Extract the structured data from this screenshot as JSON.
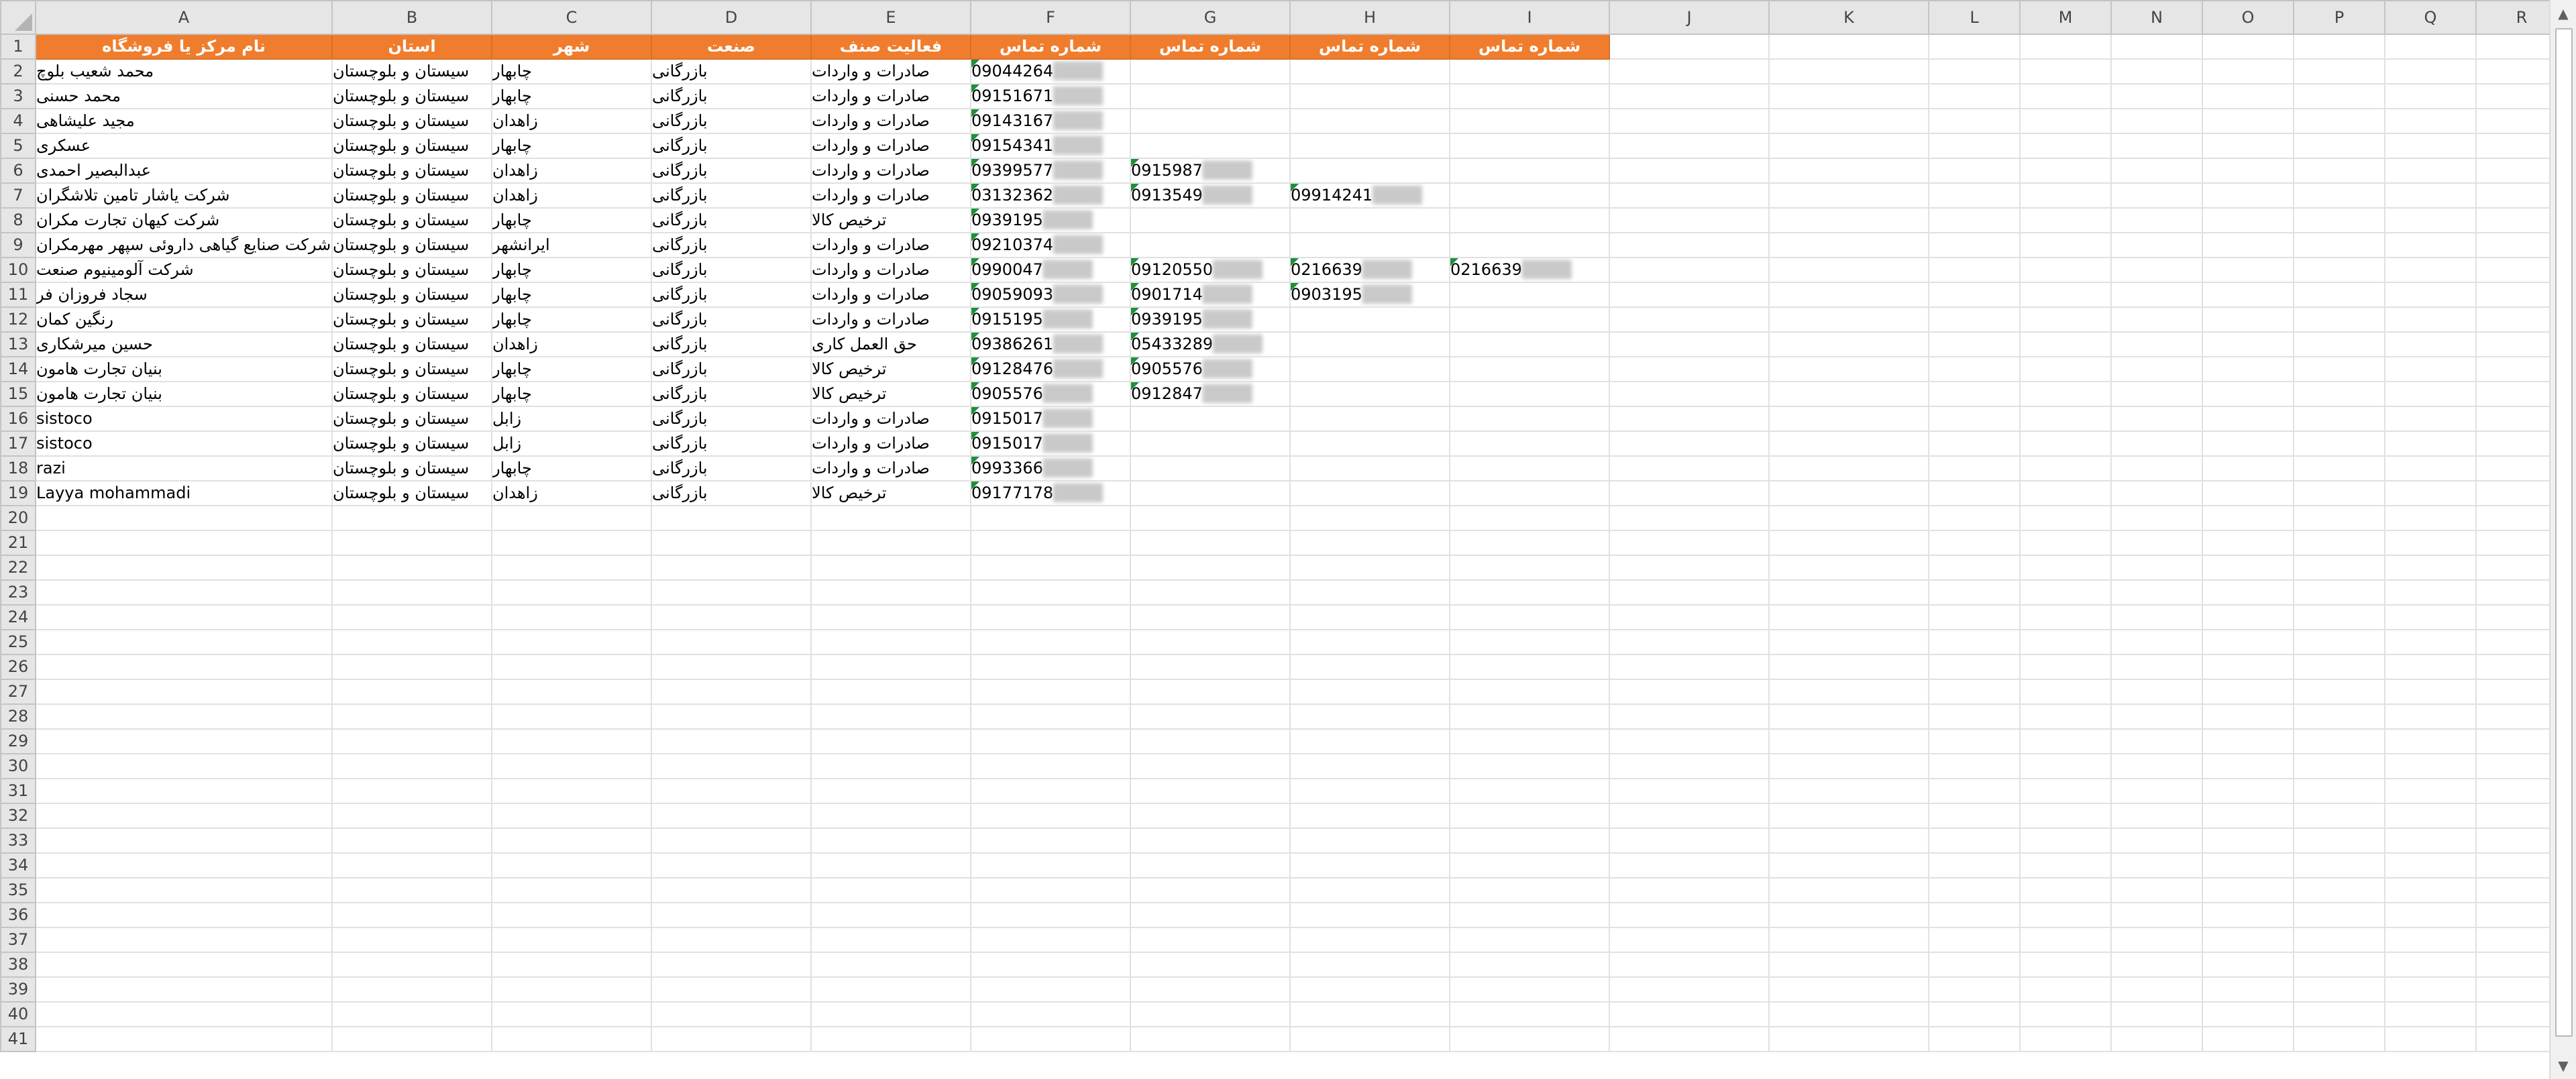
{
  "columns": [
    "A",
    "B",
    "C",
    "D",
    "E",
    "F",
    "G",
    "H",
    "I",
    "J",
    "K",
    "L",
    "M",
    "N",
    "O",
    "P",
    "Q",
    "R"
  ],
  "header": {
    "A": "نام مرکز یا فروشگاه",
    "B": "استان",
    "C": "شهر",
    "D": "صنعت",
    "E": "فعالیت صنف",
    "F": "شماره تماس",
    "G": "شماره تماس",
    "H": "شماره تماس",
    "I": "شماره تماس"
  },
  "rows": [
    {
      "A": "محمد شعیب بلوچ",
      "B": "سیستان و بلوچستان",
      "C": "چابهار",
      "D": "بازرگانی",
      "E": "صادرات و واردات",
      "F": "09044264",
      "G": "",
      "H": "",
      "I": ""
    },
    {
      "A": "محمد حسنی",
      "B": "سیستان و بلوچستان",
      "C": "چابهار",
      "D": "بازرگانی",
      "E": "صادرات و واردات",
      "F": "09151671",
      "G": "",
      "H": "",
      "I": ""
    },
    {
      "A": "مجید علیشاهی",
      "B": "سیستان و بلوچستان",
      "C": "زاهدان",
      "D": "بازرگانی",
      "E": "صادرات و واردات",
      "F": "09143167",
      "G": "",
      "H": "",
      "I": ""
    },
    {
      "A": "عسکری",
      "B": "سیستان و بلوچستان",
      "C": "چابهار",
      "D": "بازرگانی",
      "E": "صادرات و واردات",
      "F": "09154341",
      "G": "",
      "H": "",
      "I": ""
    },
    {
      "A": "عبدالبصیر احمدی",
      "B": "سیستان و بلوچستان",
      "C": "زاهدان",
      "D": "بازرگانی",
      "E": "صادرات و واردات",
      "F": "09399577",
      "G": "0915987",
      "H": "",
      "I": ""
    },
    {
      "A": "شرکت یاشار تامین تلاشگران",
      "B": "سیستان و بلوچستان",
      "C": "زاهدان",
      "D": "بازرگانی",
      "E": "صادرات و واردات",
      "F": "03132362",
      "G": "0913549",
      "H": "09914241",
      "I": ""
    },
    {
      "A": "شرکت کیهان تجارت مکران",
      "B": "سیستان و بلوچستان",
      "C": "چابهار",
      "D": "بازرگانی",
      "E": "ترخیص کالا",
      "F": "0939195",
      "G": "",
      "H": "",
      "I": ""
    },
    {
      "A": "شرکت صنایع گیاهی داروئی سپهر مهرمکران",
      "B": "سیستان و بلوچستان",
      "C": "ایرانشهر",
      "D": "بازرگانی",
      "E": "صادرات و واردات",
      "F": "09210374",
      "G": "",
      "H": "",
      "I": ""
    },
    {
      "A": "شرکت آلومینیوم صنعت",
      "B": "سیستان و بلوچستان",
      "C": "چابهار",
      "D": "بازرگانی",
      "E": "صادرات و واردات",
      "F": "0990047",
      "G": "09120550",
      "H": "0216639",
      "I": "0216639"
    },
    {
      "A": "سجاد فروزان فر",
      "B": "سیستان و بلوچستان",
      "C": "چابهار",
      "D": "بازرگانی",
      "E": "صادرات و واردات",
      "F": "09059093",
      "G": "0901714",
      "H": "0903195",
      "I": ""
    },
    {
      "A": "رنگین کمان",
      "B": "سیستان و بلوچستان",
      "C": "چابهار",
      "D": "بازرگانی",
      "E": "صادرات و واردات",
      "F": "0915195",
      "G": "0939195",
      "H": "",
      "I": ""
    },
    {
      "A": "حسین میرشکاری",
      "B": "سیستان و بلوچستان",
      "C": "زاهدان",
      "D": "بازرگانی",
      "E": "حق العمل کاری",
      "F": "09386261",
      "G": "05433289",
      "H": "",
      "I": ""
    },
    {
      "A": "بنیان تجارت هامون",
      "B": "سیستان و بلوچستان",
      "C": "چابهار",
      "D": "بازرگانی",
      "E": "ترخیص کالا",
      "F": "09128476",
      "G": "0905576",
      "H": "",
      "I": ""
    },
    {
      "A": "بنیان تجارت هامون",
      "B": "سیستان و بلوچستان",
      "C": "چابهار",
      "D": "بازرگانی",
      "E": "ترخیص کالا",
      "F": "0905576",
      "G": "0912847",
      "H": "",
      "I": ""
    },
    {
      "A": "sistoco",
      "B": "سیستان و بلوچستان",
      "C": "زابل",
      "D": "بازرگانی",
      "E": "صادرات و واردات",
      "F": "0915017",
      "G": "",
      "H": "",
      "I": ""
    },
    {
      "A": "sistoco",
      "B": "سیستان و بلوچستان",
      "C": "زابل",
      "D": "بازرگانی",
      "E": "صادرات و واردات",
      "F": "0915017",
      "G": "",
      "H": "",
      "I": ""
    },
    {
      "A": "razi",
      "B": "سیستان و بلوچستان",
      "C": "چابهار",
      "D": "بازرگانی",
      "E": "صادرات و واردات",
      "F": "0993366",
      "G": "",
      "H": "",
      "I": ""
    },
    {
      "A": "Layya mohammadi",
      "B": "سیستان و بلوچستان",
      "C": "زاهدان",
      "D": "بازرگانی",
      "E": "ترخیص کالا",
      "F": "09177178",
      "G": "",
      "H": "",
      "I": ""
    }
  ],
  "row_numbers": [
    "1",
    "2",
    "3",
    "4",
    "5",
    "6",
    "7",
    "8",
    "9",
    "10",
    "11",
    "12",
    "13",
    "14",
    "15",
    "16",
    "17",
    "18",
    "19",
    "20",
    "21",
    "22",
    "23",
    "24",
    "25",
    "26",
    "27",
    "28",
    "29",
    "30",
    "31",
    "32",
    "33",
    "34",
    "35",
    "36",
    "37",
    "38",
    "39",
    "40",
    "41"
  ],
  "icons": {
    "scroll_up": "triangle-up",
    "scroll_down": "triangle-down"
  }
}
